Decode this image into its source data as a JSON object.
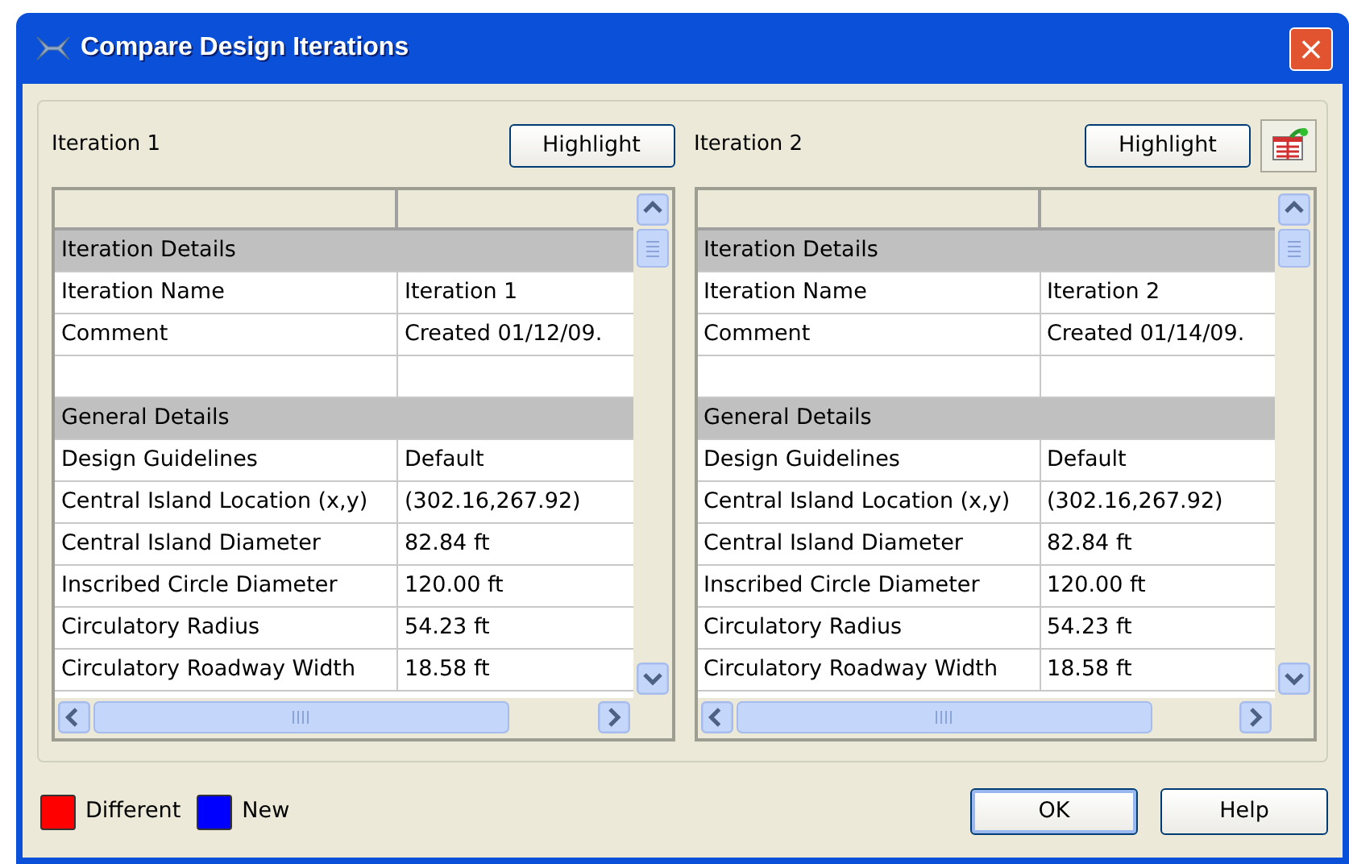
{
  "window": {
    "title": "Compare Design Iterations",
    "close": "×"
  },
  "panels": [
    {
      "label": "Iteration 1",
      "highlight": "Highlight",
      "export_button": false,
      "rows": [
        {
          "kind": "section",
          "label": "Iteration Details"
        },
        {
          "kind": "data",
          "label": "Iteration Name",
          "value": "Iteration 1"
        },
        {
          "kind": "data",
          "label": "Comment",
          "value": "Created 01/12/09."
        },
        {
          "kind": "blank"
        },
        {
          "kind": "section",
          "label": "General Details"
        },
        {
          "kind": "data",
          "label": "Design Guidelines",
          "value": "Default"
        },
        {
          "kind": "data",
          "label": "Central Island Location (x,y)",
          "value": "(302.16,267.92)"
        },
        {
          "kind": "data",
          "label": "Central Island Diameter",
          "value": "82.84 ft"
        },
        {
          "kind": "data",
          "label": "Inscribed Circle Diameter",
          "value": "120.00 ft"
        },
        {
          "kind": "data",
          "label": "Circulatory Radius",
          "value": "54.23 ft"
        },
        {
          "kind": "data",
          "label": "Circulatory Roadway Width",
          "value": "18.58 ft"
        }
      ]
    },
    {
      "label": "Iteration 2",
      "highlight": "Highlight",
      "export_button": true,
      "rows": [
        {
          "kind": "section",
          "label": "Iteration Details"
        },
        {
          "kind": "data",
          "label": "Iteration Name",
          "value": "Iteration 2"
        },
        {
          "kind": "data",
          "label": "Comment",
          "value": "Created 01/14/09."
        },
        {
          "kind": "blank"
        },
        {
          "kind": "section",
          "label": "General Details"
        },
        {
          "kind": "data",
          "label": "Design Guidelines",
          "value": "Default"
        },
        {
          "kind": "data",
          "label": "Central Island Location (x,y)",
          "value": "(302.16,267.92)"
        },
        {
          "kind": "data",
          "label": "Central Island Diameter",
          "value": "82.84 ft"
        },
        {
          "kind": "data",
          "label": "Inscribed Circle Diameter",
          "value": "120.00 ft"
        },
        {
          "kind": "data",
          "label": "Circulatory Radius",
          "value": "54.23 ft"
        },
        {
          "kind": "data",
          "label": "Circulatory Roadway Width",
          "value": "18.58 ft"
        }
      ]
    }
  ],
  "legend": [
    {
      "label": "Different",
      "color": "#ff0000"
    },
    {
      "label": "New",
      "color": "#0000ff"
    }
  ],
  "buttons": [
    {
      "label": "OK",
      "default": true
    },
    {
      "label": "Help",
      "default": false
    }
  ]
}
